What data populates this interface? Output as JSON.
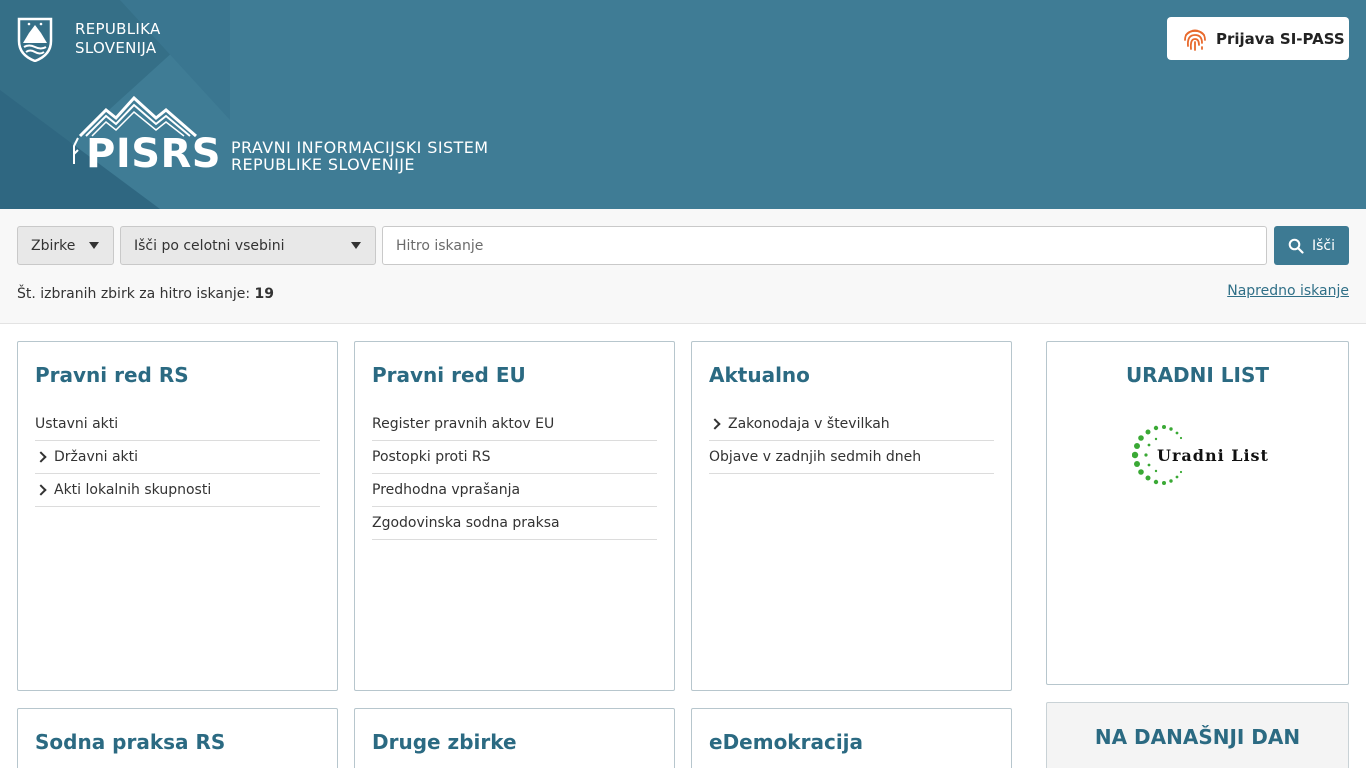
{
  "header": {
    "gov_line1": "REPUBLIKA",
    "gov_line2": "SLOVENIJA",
    "logo_word": "PISRS",
    "subtitle_line1": "PRAVNI INFORMACIJSKI SISTEM",
    "subtitle_line2": "REPUBLIKE SLOVENIJE",
    "login_label": "Prijava SI-PASS"
  },
  "search": {
    "collections_select": "Zbirke",
    "scope_select": "Išči po celotni vsebini",
    "input_placeholder": "Hitro iskanje",
    "button_label": "Išči",
    "count_label": "Št. izbranih zbirk za hitro iskanje:",
    "count_value": "19",
    "advanced_link": "Napredno iskanje"
  },
  "cards": {
    "pravni_red_rs": {
      "title": "Pravni red RS",
      "items": [
        {
          "label": "Ustavni akti",
          "expandable": false
        },
        {
          "label": "Državni akti",
          "expandable": true
        },
        {
          "label": "Akti lokalnih skupnosti",
          "expandable": true
        }
      ]
    },
    "pravni_red_eu": {
      "title": "Pravni red EU",
      "items": [
        {
          "label": "Register pravnih aktov EU",
          "expandable": false
        },
        {
          "label": "Postopki proti RS",
          "expandable": false
        },
        {
          "label": "Predhodna vprašanja",
          "expandable": false
        },
        {
          "label": "Zgodovinska sodna praksa",
          "expandable": false
        }
      ]
    },
    "aktualno": {
      "title": "Aktualno",
      "items": [
        {
          "label": "Zakonodaja v številkah",
          "expandable": true
        },
        {
          "label": "Objave v zadnjih sedmih dneh",
          "expandable": false
        }
      ]
    },
    "uradni_list": {
      "title": "URADNI LIST",
      "logo_text": "Uradni List"
    },
    "sodna_praksa": {
      "title": "Sodna praksa RS"
    },
    "druge_zbirke": {
      "title": "Druge zbirke"
    },
    "edemokracija": {
      "title": "eDemokracija"
    },
    "na_danasnji_dan": {
      "title": "NA DANAŠNJI DAN"
    }
  },
  "colors": {
    "header_bg": "#3f7c95",
    "accent": "#2b6a82",
    "button_bg": "#3d7a93",
    "login_icon": "#e8692c",
    "logo_green": "#3aa935"
  },
  "icons": {
    "crest": "slovenia-crest-icon",
    "fingerprint": "fingerprint-icon",
    "search": "search-icon",
    "chevron": "chevron-right-icon",
    "caret": "caret-down-icon"
  }
}
